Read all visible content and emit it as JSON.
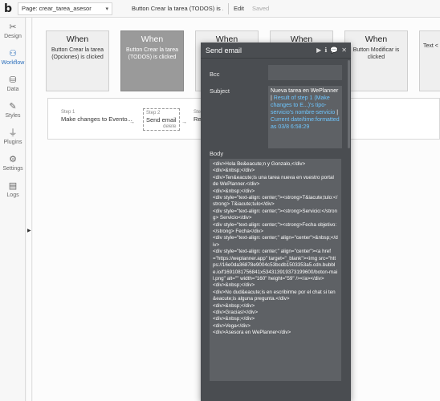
{
  "topbar": {
    "logo": "b",
    "page_selector": "Page: crear_tarea_asesor",
    "event_selector": "Button Crear la tarea (TODOS) is ...",
    "edit_label": "Edit",
    "saved_label": "Saved"
  },
  "sidebar": {
    "items": [
      {
        "label": "Design",
        "icon": "design-icon",
        "glyph": "✂"
      },
      {
        "label": "Workflow",
        "icon": "workflow-icon",
        "glyph": "⚇"
      },
      {
        "label": "Data",
        "icon": "data-icon",
        "glyph": "⛁"
      },
      {
        "label": "Styles",
        "icon": "styles-icon",
        "glyph": "✎"
      },
      {
        "label": "Plugins",
        "icon": "plugins-icon",
        "glyph": "⏚"
      },
      {
        "label": "Settings",
        "icon": "settings-icon",
        "glyph": "⚙"
      },
      {
        "label": "Logs",
        "icon": "logs-icon",
        "glyph": "▤"
      }
    ],
    "active": "Workflow"
  },
  "workflows": [
    {
      "when": "When",
      "desc": "Button Crear la tarea (Opciones) is clicked"
    },
    {
      "when": "When",
      "desc": "Button Crear la tarea (TODOS) is clicked"
    },
    {
      "when": "When",
      "desc": ""
    },
    {
      "when": "When",
      "desc": ""
    },
    {
      "when": "When",
      "desc": "Button Modificar is clicked"
    },
    {
      "when": "",
      "desc": "Text <"
    }
  ],
  "steps": [
    {
      "num": "Step 1",
      "title": "Make changes to Evento..."
    },
    {
      "num": "Step 2",
      "title": "Send email",
      "delete": "delete"
    },
    {
      "num": "Step",
      "title": "Re"
    }
  ],
  "modal": {
    "title": "Send email",
    "controls": [
      "▶",
      "ℹ",
      "💬",
      "✕"
    ],
    "bcc_label": "Bcc",
    "subject_label": "Subject",
    "subject_static": "Nueva tarea en WePlanner | ",
    "subject_dynamic": "Result of step 1 (Make changes to E...)'s tipo-servicio's nombre-servicio",
    "subject_sep": " | ",
    "subject_dynamic2": "Current date/time:formatted as 03/8 6:58:29",
    "body_label": "Body",
    "body_lines": [
      "<div>Hola Be&eacute;n y Gonzalo,</div>",
      "<div>&nbsp;</div>",
      "<div>Ten&eacute;is una tarea nueva en vuestro portal de WePlanner.</div>",
      "<div>&nbsp;</div>",
      "<div style=\"text-align: center;\"><strong>T&iacute;tulo:</strong> T&iacute;tulo</div>",
      "<div style=\"text-align: center;\"><strong>Servicio:</strong> Servicio</div>",
      "<div style=\"text-align: center;\"><strong>Fecha objetivo:</strong> Fecha</div>",
      "<div style=\"text-align: center;\" align=\"center\">&nbsp;</div>",
      "<div style=\"text-align: center;\" align=\"center\"><a href=\"https://weplanner.app\" target=\"_blank\"><img src=\"https://16e0da36878e9004c53bcdb1503353a5.cdn.bubble.io/f1691081756841x534313919373199600/boton-mail.png\" alt=\"\" width=\"160\" height=\"59\" /></a></div>",
      "<div>&nbsp;</div>",
      "<div>No dud&eacute;is en escribirme por el chat si ten&eacute;is alguna pregunta.</div>",
      "<div>&nbsp;</div>",
      "<div>Gracias!</div>",
      "<div>&nbsp;</div>",
      "<div>Vega</div>",
      "<div>Asesora en WePlanner</div>"
    ]
  }
}
